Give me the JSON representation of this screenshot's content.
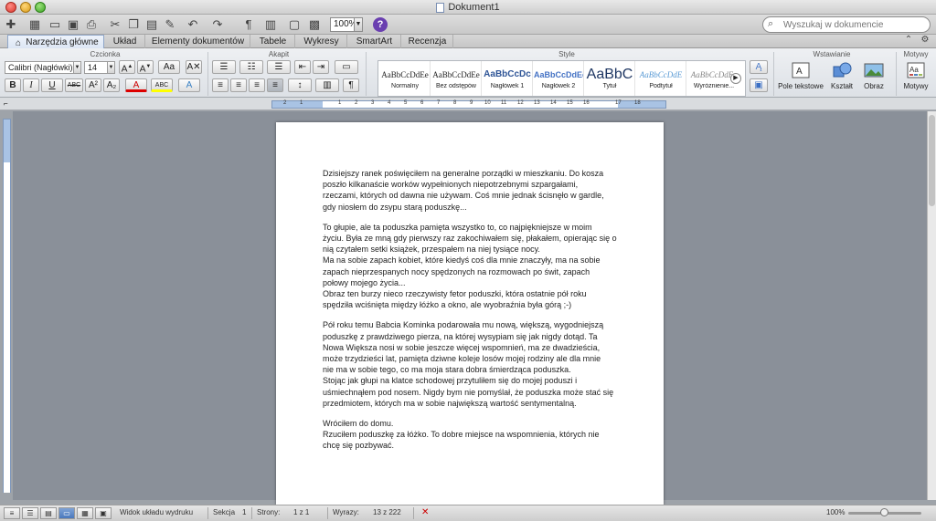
{
  "window": {
    "title": "Dokument1"
  },
  "toolbar": {
    "zoom": "100%",
    "search_placeholder": "Wyszukaj w dokumencie"
  },
  "ribbon_tabs": [
    {
      "label": "Narzędzia główne",
      "active": true
    },
    {
      "label": "Układ"
    },
    {
      "label": "Elementy dokumentów"
    },
    {
      "label": "Tabele"
    },
    {
      "label": "Wykresy"
    },
    {
      "label": "SmartArt"
    },
    {
      "label": "Recenzja"
    }
  ],
  "ribbon": {
    "groups": {
      "czcionka": "Czcionka",
      "akapit": "Akapit",
      "style": "Style",
      "wstawianie": "Wstawianie",
      "motywy": "Motywy"
    },
    "font_name": "Calibri (Nagłówki)",
    "font_size": "14",
    "styles": [
      {
        "sample": "AaBbCcDdEe",
        "name": "Normalny"
      },
      {
        "sample": "AaBbCcDdEe",
        "name": "Bez odstępów"
      },
      {
        "sample": "AaBbCcDc",
        "name": "Nagłówek 1"
      },
      {
        "sample": "AaBbCcDdEe",
        "name": "Nagłówek 2"
      },
      {
        "sample": "AaBbC",
        "name": "Tytuł"
      },
      {
        "sample": "AaBbCcDdE",
        "name": "Podtytuł"
      },
      {
        "sample": "AaBbCcDdEe",
        "name": "Wyróżnienie..."
      }
    ],
    "insert": {
      "text_box": "Pole tekstowe",
      "shape": "Kształt",
      "picture": "Obraz",
      "themes": "Motywy"
    }
  },
  "document": {
    "lines": [
      "Dzisiejszy ranek poświęciłem na generalne porządki w mieszkaniu. Do kosza",
      "poszło kilkanaście worków wypełnionych niepotrzebnymi szpargałami,",
      "rzeczami, których od dawna nie używam. Coś mnie jednak ścisnęło w gardle,",
      "gdy niosłem do zsypu starą poduszkę...",
      "",
      "To głupie, ale ta poduszka pamięta wszystko to, co najpiękniejsze w moim",
      "życiu. Była ze mną gdy pierwszy raz zakochiwałem się, płakałem, opierając się o",
      "nią czytałem setki książek, przespałem na niej tysiące nocy.",
      "Ma na sobie zapach kobiet, które kiedyś coś dla mnie znaczyły, ma na sobie",
      "zapach nieprzespanych nocy spędzonych na rozmowach po świt, zapach",
      "połowy mojego życia...",
      "Obraz ten burzy nieco rzeczywisty fetor poduszki, która ostatnie pół roku",
      "spędziła wciśnięta między łóżko a okno, ale wyobraźnia była górą ;-)",
      "",
      "Pół roku temu Babcia Kominka podarowała mu nową, większą, wygodniejszą",
      "poduszkę z prawdziwego pierza, na której wysypiam się jak nigdy dotąd. Ta",
      "Nowa Większa nosi w sobie jeszcze więcej wspomnień, ma ze dwadzieścia,",
      "może trzydzieści lat, pamięta dziwne koleje losów mojej rodziny ale dla mnie",
      "nie ma w sobie tego, co ma moja stara dobra śmierdząca poduszka.",
      "Stojąc jak głupi na klatce schodowej przytuliłem się do mojej poduszi i",
      "uśmiechnąłem pod nosem. Nigdy bym nie pomyślał, że poduszka może stać się",
      "przedmiotem, których ma w sobie największą wartość sentymentalną.",
      "",
      "Wróciłem do domu.",
      "Rzuciłem poduszkę za łóżko. To dobre miejsce na wspomnienia, których nie",
      "chcę się pozbywać."
    ]
  },
  "status": {
    "view_label": "Widok układu wydruku",
    "section_label": "Sekcja",
    "section_value": "1",
    "pages_label": "Strony:",
    "pages_value": "1 z 1",
    "words_label": "Wyrazy:",
    "words_value": "13 z 222",
    "zoom": "100%"
  }
}
